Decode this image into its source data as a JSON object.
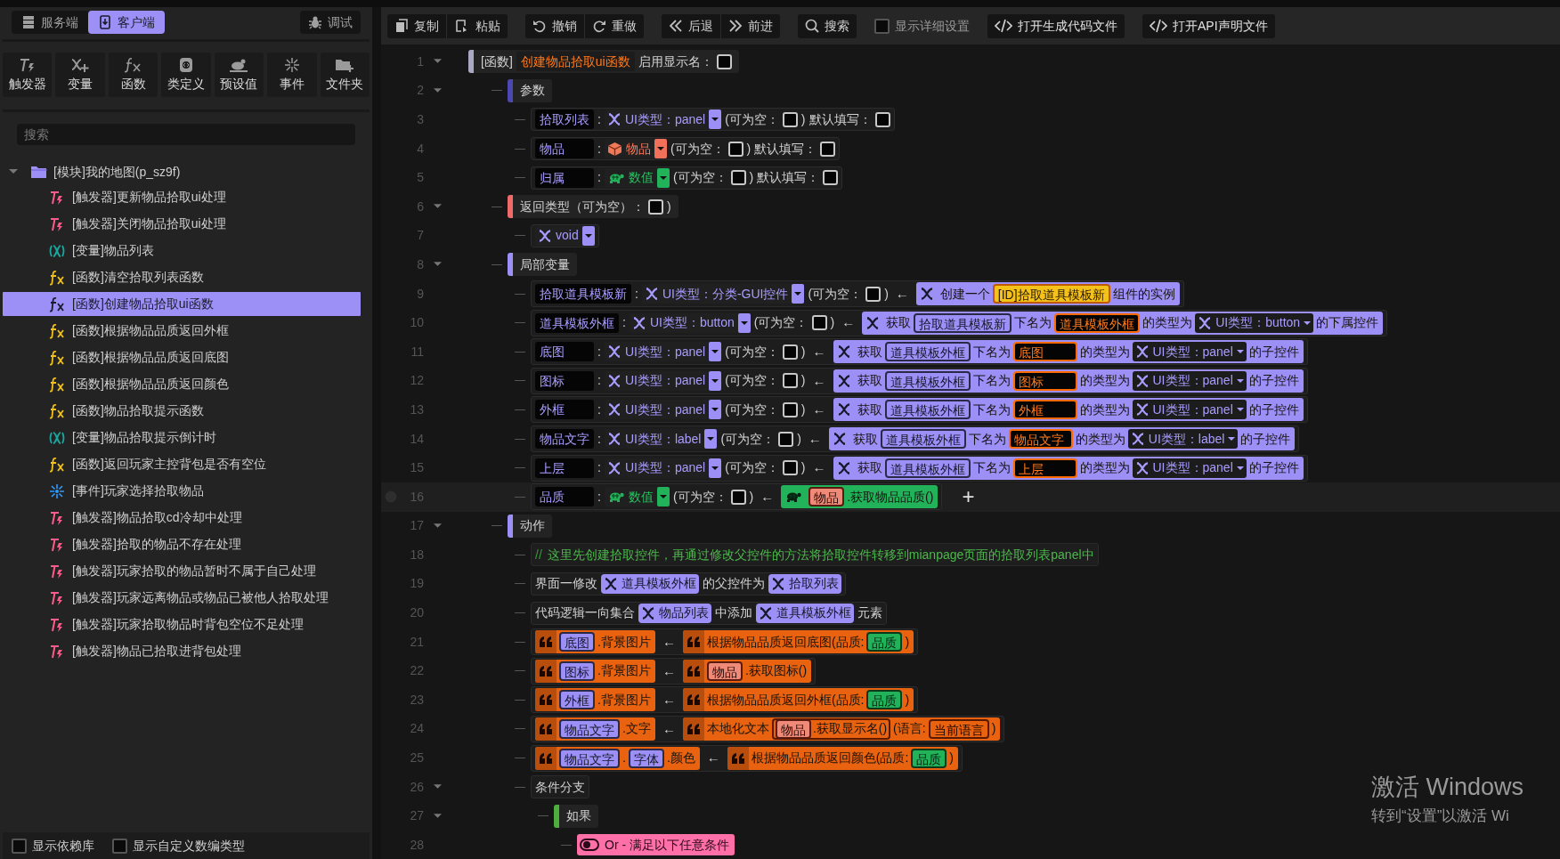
{
  "side_tabs": [
    {
      "label": "服务端",
      "kind": "server",
      "selected": false
    },
    {
      "label": "客户端",
      "kind": "client",
      "selected": true
    }
  ],
  "debug_button": {
    "label": "调试"
  },
  "create_tools": [
    {
      "label": "触发器",
      "kind": "trigger"
    },
    {
      "label": "变量",
      "kind": "variable"
    },
    {
      "label": "函数",
      "kind": "function"
    },
    {
      "label": "类定义",
      "kind": "class"
    },
    {
      "label": "预设值",
      "kind": "preset"
    },
    {
      "label": "事件",
      "kind": "event"
    },
    {
      "label": "文件夹",
      "kind": "folder"
    }
  ],
  "search": {
    "placeholder": "搜索"
  },
  "module_tree": {
    "label": "[模块]我的地图(p_sz9f)",
    "expanded": true,
    "children": [
      {
        "label": "[触发器]更新物品拾取ui处理",
        "kind": "trigger",
        "selected": false
      },
      {
        "label": "[触发器]关闭物品拾取ui处理",
        "kind": "trigger",
        "selected": false
      },
      {
        "label": "[变量]物品列表",
        "kind": "variable",
        "selected": false
      },
      {
        "label": "[函数]清空拾取列表函数",
        "kind": "function",
        "selected": false
      },
      {
        "label": "[函数]创建物品拾取ui函数",
        "kind": "function",
        "selected": true
      },
      {
        "label": "[函数]根据物品品质返回外框",
        "kind": "function",
        "selected": false
      },
      {
        "label": "[函数]根据物品品质返回底图",
        "kind": "function",
        "selected": false
      },
      {
        "label": "[函数]根据物品品质返回颜色",
        "kind": "function",
        "selected": false
      },
      {
        "label": "[函数]物品拾取提示函数",
        "kind": "function",
        "selected": false
      },
      {
        "label": "[变量]物品拾取提示倒计时",
        "kind": "variable",
        "selected": false
      },
      {
        "label": "[函数]返回玩家主控背包是否有空位",
        "kind": "function",
        "selected": false
      },
      {
        "label": "[事件]玩家选择拾取物品",
        "kind": "event",
        "selected": false
      },
      {
        "label": "[触发器]物品拾取cd冷却中处理",
        "kind": "trigger",
        "selected": false
      },
      {
        "label": "[触发器]拾取的物品不存在处理",
        "kind": "trigger",
        "selected": false
      },
      {
        "label": "[触发器]玩家拾取的物品暂时不属于自己处理",
        "kind": "trigger",
        "selected": false
      },
      {
        "label": "[触发器]玩家远离物品或物品已被他人拾取处理",
        "kind": "trigger",
        "selected": false
      },
      {
        "label": "[触发器]玩家拾取物品时背包空位不足处理",
        "kind": "trigger",
        "selected": false
      },
      {
        "label": "[触发器]物品已拾取进背包处理",
        "kind": "trigger",
        "selected": false
      }
    ]
  },
  "footer_options": [
    {
      "label": "显示依赖库",
      "checked": false
    },
    {
      "label": "显示自定义数编类型",
      "checked": false
    }
  ],
  "toolbar": {
    "groups": [
      [
        {
          "label": "复制",
          "kind": "copy"
        },
        {
          "label": "粘贴",
          "kind": "paste"
        }
      ],
      [
        {
          "label": "撤销",
          "kind": "undo"
        },
        {
          "label": "重做",
          "kind": "redo"
        }
      ],
      [
        {
          "label": "后退",
          "kind": "back"
        },
        {
          "label": "前进",
          "kind": "forward"
        }
      ],
      [
        {
          "label": "搜索",
          "kind": "search"
        }
      ]
    ],
    "detail_option": {
      "label": "显示详细设置",
      "checked": false
    },
    "file_buttons": [
      {
        "label": "打开生成代码文件"
      },
      {
        "label": "打开API声明文件"
      }
    ]
  },
  "editor": {
    "lines": [
      {
        "line": "1",
        "expanded": true,
        "selected": false,
        "parts": [
          {
            "kind": "section",
            "color": "#a9a9c4",
            "parts": [
              {
                "kind": "text",
                "text": "[函数]"
              },
              {
                "kind": "function_name",
                "text": "创建物品拾取ui函数"
              },
              {
                "kind": "text",
                "text": "启用显示名："
              },
              {
                "kind": "check",
                "checked": false
              }
            ]
          }
        ],
        "children": [
          {
            "line": "2",
            "expanded": true,
            "selected": false,
            "parts": [
              {
                "kind": "section",
                "color": "#4b48b0",
                "parts": [
                  {
                    "kind": "text",
                    "text": "参数"
                  }
                ]
              }
            ],
            "children": [
              {
                "line": "3",
                "selected": false,
                "parts": [
                  {
                    "kind": "variable_name",
                    "text": "拾取列表"
                  },
                  {
                    "kind": "text",
                    "text": ":"
                  },
                  {
                    "kind": "ui_type",
                    "text": "UI类型：panel"
                  },
                  {
                    "kind": "text",
                    "text": "(可为空："
                  },
                  {
                    "kind": "check",
                    "checked": false
                  },
                  {
                    "kind": "text",
                    "text": ")"
                  },
                  {
                    "kind": "text",
                    "text": "默认填写："
                  },
                  {
                    "kind": "check",
                    "checked": false
                  }
                ]
              },
              {
                "line": "4",
                "selected": false,
                "parts": [
                  {
                    "kind": "variable_name",
                    "text": "物品"
                  },
                  {
                    "kind": "text",
                    "text": ":"
                  },
                  {
                    "kind": "item_type",
                    "text": "物品"
                  },
                  {
                    "kind": "text",
                    "text": "(可为空："
                  },
                  {
                    "kind": "check",
                    "checked": false
                  },
                  {
                    "kind": "text",
                    "text": ")"
                  },
                  {
                    "kind": "text",
                    "text": "默认填写："
                  },
                  {
                    "kind": "check",
                    "checked": false
                  }
                ]
              },
              {
                "line": "5",
                "selected": false,
                "parts": [
                  {
                    "kind": "variable_name",
                    "text": "归属"
                  },
                  {
                    "kind": "text",
                    "text": ":"
                  },
                  {
                    "kind": "number_type",
                    "text": "数值"
                  },
                  {
                    "kind": "text",
                    "text": "(可为空："
                  },
                  {
                    "kind": "check",
                    "checked": false
                  },
                  {
                    "kind": "text",
                    "text": ")"
                  },
                  {
                    "kind": "text",
                    "text": "默认填写："
                  },
                  {
                    "kind": "check",
                    "checked": false
                  }
                ]
              }
            ]
          },
          {
            "line": "6",
            "expanded": true,
            "selected": false,
            "parts": [
              {
                "kind": "section",
                "color": "#f06a6a",
                "parts": [
                  {
                    "kind": "text",
                    "text": "返回类型（可为空）："
                  },
                  {
                    "kind": "check",
                    "checked": false
                  },
                  {
                    "kind": "text",
                    "text": ")"
                  }
                ]
              }
            ],
            "children": [
              {
                "line": "7",
                "selected": false,
                "parts": [
                  {
                    "kind": "ui_type",
                    "text": "void"
                  }
                ]
              }
            ]
          },
          {
            "line": "8",
            "expanded": true,
            "selected": false,
            "parts": [
              {
                "kind": "section",
                "color": "#9c8ff6",
                "parts": [
                  {
                    "kind": "text",
                    "text": "局部变量"
                  }
                ]
              }
            ],
            "children": [
              {
                "line": "9",
                "selected": false,
                "parts": [
                  {
                    "kind": "variable_name",
                    "text": "拾取道具模板新"
                  },
                  {
                    "kind": "text",
                    "text": ":"
                  },
                  {
                    "kind": "ui_type",
                    "text": "UI类型：分类-GUI控件"
                  },
                  {
                    "kind": "text",
                    "text": "(可为空："
                  },
                  {
                    "kind": "check",
                    "checked": false
                  },
                  {
                    "kind": "text",
                    "text": ")"
                  },
                  {
                    "kind": "arrow",
                    "text": "←"
                  },
                  {
                    "kind": "ui_call",
                    "parts": [
                      {
                        "kind": "text",
                        "text": "创建一个"
                      },
                      {
                        "kind": "id_ref",
                        "text": "[ID]拾取道具模板新"
                      },
                      {
                        "kind": "text",
                        "text": "组件的实例"
                      }
                    ]
                  }
                ]
              },
              {
                "line": "10",
                "selected": false,
                "parts": [
                  {
                    "kind": "variable_name",
                    "text": "道具模板外框"
                  },
                  {
                    "kind": "text",
                    "text": ":"
                  },
                  {
                    "kind": "ui_type",
                    "text": "UI类型：button"
                  },
                  {
                    "kind": "text",
                    "text": "(可为空："
                  },
                  {
                    "kind": "check",
                    "checked": false
                  },
                  {
                    "kind": "text",
                    "text": ")"
                  },
                  {
                    "kind": "arrow",
                    "text": "←"
                  },
                  {
                    "kind": "ui_call",
                    "parts": [
                      {
                        "kind": "text",
                        "text": "获取"
                      },
                      {
                        "kind": "ui_ref",
                        "text": "拾取道具模板新"
                      },
                      {
                        "kind": "text",
                        "text": "下名为"
                      },
                      {
                        "kind": "string_ref",
                        "text": "道具模板外框"
                      },
                      {
                        "kind": "text",
                        "text": "的类型为"
                      },
                      {
                        "kind": "type_chip",
                        "text": "UI类型：button"
                      },
                      {
                        "kind": "text",
                        "text": "的下属控件"
                      }
                    ]
                  }
                ]
              },
              {
                "line": "11",
                "selected": false,
                "parts": [
                  {
                    "kind": "variable_name",
                    "text": "底图"
                  },
                  {
                    "kind": "text",
                    "text": ":"
                  },
                  {
                    "kind": "ui_type",
                    "text": "UI类型：panel"
                  },
                  {
                    "kind": "text",
                    "text": "(可为空："
                  },
                  {
                    "kind": "check",
                    "checked": false
                  },
                  {
                    "kind": "text",
                    "text": ")"
                  },
                  {
                    "kind": "arrow",
                    "text": "←"
                  },
                  {
                    "kind": "ui_call",
                    "parts": [
                      {
                        "kind": "text",
                        "text": "获取"
                      },
                      {
                        "kind": "ui_ref",
                        "text": "道具模板外框"
                      },
                      {
                        "kind": "text",
                        "text": "下名为"
                      },
                      {
                        "kind": "string_ref",
                        "text": "底图"
                      },
                      {
                        "kind": "text",
                        "text": "的类型为"
                      },
                      {
                        "kind": "type_chip",
                        "text": "UI类型：panel"
                      },
                      {
                        "kind": "text",
                        "text": "的子控件"
                      }
                    ]
                  }
                ]
              },
              {
                "line": "12",
                "selected": false,
                "parts": [
                  {
                    "kind": "variable_name",
                    "text": "图标"
                  },
                  {
                    "kind": "text",
                    "text": ":"
                  },
                  {
                    "kind": "ui_type",
                    "text": "UI类型：panel"
                  },
                  {
                    "kind": "text",
                    "text": "(可为空："
                  },
                  {
                    "kind": "check",
                    "checked": false
                  },
                  {
                    "kind": "text",
                    "text": ")"
                  },
                  {
                    "kind": "arrow",
                    "text": "←"
                  },
                  {
                    "kind": "ui_call",
                    "parts": [
                      {
                        "kind": "text",
                        "text": "获取"
                      },
                      {
                        "kind": "ui_ref",
                        "text": "道具模板外框"
                      },
                      {
                        "kind": "text",
                        "text": "下名为"
                      },
                      {
                        "kind": "string_ref",
                        "text": "图标"
                      },
                      {
                        "kind": "text",
                        "text": "的类型为"
                      },
                      {
                        "kind": "type_chip",
                        "text": "UI类型：panel"
                      },
                      {
                        "kind": "text",
                        "text": "的子控件"
                      }
                    ]
                  }
                ]
              },
              {
                "line": "13",
                "selected": false,
                "parts": [
                  {
                    "kind": "variable_name",
                    "text": "外框"
                  },
                  {
                    "kind": "text",
                    "text": ":"
                  },
                  {
                    "kind": "ui_type",
                    "text": "UI类型：panel"
                  },
                  {
                    "kind": "text",
                    "text": "(可为空："
                  },
                  {
                    "kind": "check",
                    "checked": false
                  },
                  {
                    "kind": "text",
                    "text": ")"
                  },
                  {
                    "kind": "arrow",
                    "text": "←"
                  },
                  {
                    "kind": "ui_call",
                    "parts": [
                      {
                        "kind": "text",
                        "text": "获取"
                      },
                      {
                        "kind": "ui_ref",
                        "text": "道具模板外框"
                      },
                      {
                        "kind": "text",
                        "text": "下名为"
                      },
                      {
                        "kind": "string_ref",
                        "text": "外框"
                      },
                      {
                        "kind": "text",
                        "text": "的类型为"
                      },
                      {
                        "kind": "type_chip",
                        "text": "UI类型：panel"
                      },
                      {
                        "kind": "text",
                        "text": "的子控件"
                      }
                    ]
                  }
                ]
              },
              {
                "line": "14",
                "selected": false,
                "parts": [
                  {
                    "kind": "variable_name",
                    "text": "物品文字"
                  },
                  {
                    "kind": "text",
                    "text": ":"
                  },
                  {
                    "kind": "ui_type",
                    "text": "UI类型：label"
                  },
                  {
                    "kind": "text",
                    "text": "(可为空："
                  },
                  {
                    "kind": "check",
                    "checked": false
                  },
                  {
                    "kind": "text",
                    "text": ")"
                  },
                  {
                    "kind": "arrow",
                    "text": "←"
                  },
                  {
                    "kind": "ui_call",
                    "parts": [
                      {
                        "kind": "text",
                        "text": "获取"
                      },
                      {
                        "kind": "ui_ref",
                        "text": "道具模板外框"
                      },
                      {
                        "kind": "text",
                        "text": "下名为"
                      },
                      {
                        "kind": "string_ref",
                        "text": "物品文字"
                      },
                      {
                        "kind": "text",
                        "text": "的类型为"
                      },
                      {
                        "kind": "type_chip",
                        "text": "UI类型：label"
                      },
                      {
                        "kind": "text",
                        "text": "的子控件"
                      }
                    ]
                  }
                ]
              },
              {
                "line": "15",
                "selected": false,
                "parts": [
                  {
                    "kind": "variable_name",
                    "text": "上层"
                  },
                  {
                    "kind": "text",
                    "text": ":"
                  },
                  {
                    "kind": "ui_type",
                    "text": "UI类型：panel"
                  },
                  {
                    "kind": "text",
                    "text": "(可为空："
                  },
                  {
                    "kind": "check",
                    "checked": false
                  },
                  {
                    "kind": "text",
                    "text": ")"
                  },
                  {
                    "kind": "arrow",
                    "text": "←"
                  },
                  {
                    "kind": "ui_call",
                    "parts": [
                      {
                        "kind": "text",
                        "text": "获取"
                      },
                      {
                        "kind": "ui_ref",
                        "text": "道具模板外框"
                      },
                      {
                        "kind": "text",
                        "text": "下名为"
                      },
                      {
                        "kind": "string_ref",
                        "text": "上层"
                      },
                      {
                        "kind": "text",
                        "text": "的类型为"
                      },
                      {
                        "kind": "type_chip",
                        "text": "UI类型：panel"
                      },
                      {
                        "kind": "text",
                        "text": "的子控件"
                      }
                    ]
                  }
                ]
              },
              {
                "line": "16",
                "selected": true,
                "parts": [
                  {
                    "kind": "variable_name",
                    "text": "品质"
                  },
                  {
                    "kind": "text",
                    "text": ":"
                  },
                  {
                    "kind": "number_type",
                    "text": "数值"
                  },
                  {
                    "kind": "text",
                    "text": "(可为空："
                  },
                  {
                    "kind": "check",
                    "checked": false
                  },
                  {
                    "kind": "text",
                    "text": ")"
                  },
                  {
                    "kind": "arrow",
                    "text": "←"
                  },
                  {
                    "kind": "number_call",
                    "parts": [
                      {
                        "kind": "item_ref",
                        "text": "物品"
                      },
                      {
                        "kind": "text",
                        "text": ".获取物品品质()"
                      }
                    ]
                  },
                  {
                    "kind": "add",
                    "text": "+"
                  }
                ]
              }
            ]
          },
          {
            "line": "17",
            "expanded": true,
            "selected": false,
            "parts": [
              {
                "kind": "section",
                "color": "#9c8ff6",
                "parts": [
                  {
                    "kind": "text",
                    "text": "动作"
                  }
                ]
              }
            ],
            "children": [
              {
                "line": "18",
                "selected": false,
                "parts": [
                  {
                    "kind": "comment",
                    "marker": "//",
                    "text": "这里先创建拾取控件，再通过修改父控件的方法将拾取控件转移到mianpage页面的拾取列表panel中"
                  }
                ]
              },
              {
                "line": "19",
                "selected": false,
                "parts": [
                  {
                    "kind": "text",
                    "text": "界面一修改"
                  },
                  {
                    "kind": "var",
                    "text": "道具模板外框"
                  },
                  {
                    "kind": "text",
                    "text": "的父控件为"
                  },
                  {
                    "kind": "var",
                    "text": "拾取列表"
                  }
                ]
              },
              {
                "line": "20",
                "selected": false,
                "parts": [
                  {
                    "kind": "text",
                    "text": "代码逻辑一向集合"
                  },
                  {
                    "kind": "var",
                    "text": "物品列表"
                  },
                  {
                    "kind": "text",
                    "text": "中添加"
                  },
                  {
                    "kind": "var",
                    "text": "道具模板外框"
                  },
                  {
                    "kind": "text",
                    "text": "元素"
                  }
                ]
              },
              {
                "line": "21",
                "selected": false,
                "parts": [
                  {
                    "kind": "action_call",
                    "parts": [
                      {
                        "kind": "ui_ref",
                        "text": "底图"
                      },
                      {
                        "kind": "text",
                        "text": ".背景图片"
                      }
                    ]
                  },
                  {
                    "kind": "arrow",
                    "text": "←"
                  },
                  {
                    "kind": "action_call",
                    "parts": [
                      {
                        "kind": "text",
                        "text": "根据物品品质返回底图(品质:"
                      },
                      {
                        "kind": "number_ref",
                        "text": "品质"
                      },
                      {
                        "kind": "text",
                        "text": ")"
                      }
                    ]
                  }
                ]
              },
              {
                "line": "22",
                "selected": false,
                "parts": [
                  {
                    "kind": "action_call",
                    "parts": [
                      {
                        "kind": "ui_ref",
                        "text": "图标"
                      },
                      {
                        "kind": "text",
                        "text": ".背景图片"
                      }
                    ]
                  },
                  {
                    "kind": "arrow",
                    "text": "←"
                  },
                  {
                    "kind": "action_call",
                    "parts": [
                      {
                        "kind": "item_ref",
                        "text": "物品"
                      },
                      {
                        "kind": "text",
                        "text": ".获取图标()"
                      }
                    ]
                  }
                ]
              },
              {
                "line": "23",
                "selected": false,
                "parts": [
                  {
                    "kind": "action_call",
                    "parts": [
                      {
                        "kind": "ui_ref",
                        "text": "外框"
                      },
                      {
                        "kind": "text",
                        "text": ".背景图片"
                      }
                    ]
                  },
                  {
                    "kind": "arrow",
                    "text": "←"
                  },
                  {
                    "kind": "action_call",
                    "parts": [
                      {
                        "kind": "text",
                        "text": "根据物品品质返回外框(品质:"
                      },
                      {
                        "kind": "number_ref",
                        "text": "品质"
                      },
                      {
                        "kind": "text",
                        "text": ")"
                      }
                    ]
                  }
                ]
              },
              {
                "line": "24",
                "selected": false,
                "parts": [
                  {
                    "kind": "action_call",
                    "parts": [
                      {
                        "kind": "ui_ref",
                        "text": "物品文字"
                      },
                      {
                        "kind": "text",
                        "text": ".文字"
                      }
                    ]
                  },
                  {
                    "kind": "arrow",
                    "text": "←"
                  },
                  {
                    "kind": "action_call",
                    "parts": [
                      {
                        "kind": "text",
                        "text": "本地化文本"
                      },
                      {
                        "kind": "group",
                        "parts": [
                          {
                            "kind": "item_ref",
                            "text": "物品"
                          },
                          {
                            "kind": "text",
                            "text": ".获取显示名()"
                          }
                        ]
                      },
                      {
                        "kind": "text",
                        "text": "(语言:"
                      },
                      {
                        "kind": "enum_ref",
                        "text": "当前语言"
                      },
                      {
                        "kind": "text",
                        "text": ")"
                      }
                    ]
                  }
                ]
              },
              {
                "line": "25",
                "selected": false,
                "parts": [
                  {
                    "kind": "action_call",
                    "parts": [
                      {
                        "kind": "ui_ref",
                        "text": "物品文字"
                      },
                      {
                        "kind": "text",
                        "text": "."
                      },
                      {
                        "kind": "ui_ref",
                        "text": "字体"
                      },
                      {
                        "kind": "text",
                        "text": ".颜色"
                      }
                    ]
                  },
                  {
                    "kind": "arrow",
                    "text": "←"
                  },
                  {
                    "kind": "action_call",
                    "parts": [
                      {
                        "kind": "text",
                        "text": "根据物品品质返回颜色(品质:"
                      },
                      {
                        "kind": "number_ref",
                        "text": "品质"
                      },
                      {
                        "kind": "text",
                        "text": ")"
                      }
                    ]
                  }
                ]
              },
              {
                "line": "26",
                "expanded": true,
                "selected": false,
                "parts": [
                  {
                    "kind": "text",
                    "text": "条件分支"
                  }
                ],
                "children": [
                  {
                    "line": "27",
                    "expanded": true,
                    "selected": false,
                    "parts": [
                      {
                        "kind": "section",
                        "color": "#4caf3c",
                        "parts": [
                          {
                            "kind": "text",
                            "text": "如果"
                          }
                        ]
                      }
                    ],
                    "children": [
                      {
                        "line": "28",
                        "selected": false,
                        "parts": [
                          {
                            "kind": "condition",
                            "text": "Or - 满足以下任意条件"
                          }
                        ]
                      }
                    ]
                  }
                ]
              }
            ]
          }
        ]
      }
    ]
  },
  "os_notice": {
    "title": "激活 Windows",
    "text": "转到“设置”以激活 Wi"
  }
}
